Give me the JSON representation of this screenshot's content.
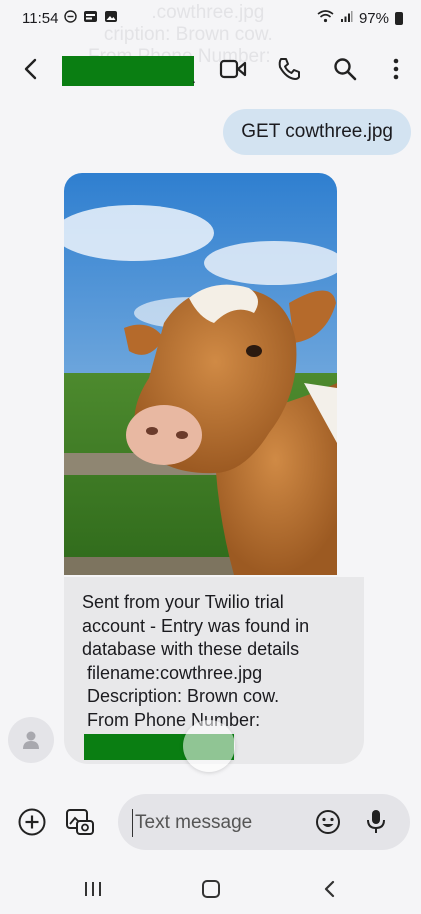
{
  "status_bar": {
    "time": "11:54",
    "battery": "97%",
    "left_icons": [
      "dnd-icon",
      "notification-icon",
      "gallery-icon"
    ],
    "right_icons": [
      "wifi-icon",
      "signal-icon",
      "battery-icon"
    ]
  },
  "ghost_text": "            .cowthree.jpg\n   cription: Brown cow.\nFrom Phone Number:",
  "app_bar": {
    "back_icon": "back-arrow-icon",
    "contact_name_redacted": true,
    "actions": [
      "video-call-icon",
      "phone-icon",
      "search-icon",
      "more-vert-icon"
    ]
  },
  "messages": {
    "outgoing": {
      "text": "GET cowthree.jpg"
    },
    "incoming_image": {
      "description": "photo-of-brown-cow"
    },
    "incoming_text": {
      "lines": [
        "Sent from your Twilio trial",
        "account - Entry was found in",
        "database with these details",
        " filename:cowthree.jpg",
        " Description: Brown cow.",
        " From Phone Number:"
      ],
      "phone_number_redacted": true
    }
  },
  "composer": {
    "placeholder": "Text message",
    "icons": [
      "add-icon",
      "gallery-camera-icon",
      "emoji-icon",
      "mic-icon"
    ]
  },
  "nav_bar": {
    "icons": [
      "recents-icon",
      "home-icon",
      "back-icon"
    ]
  },
  "colors": {
    "background": "#f5f5f7",
    "outgoing_bubble": "#d3e3f1",
    "incoming_bubble": "#e8e8ea",
    "redaction": "#0a7e12"
  }
}
